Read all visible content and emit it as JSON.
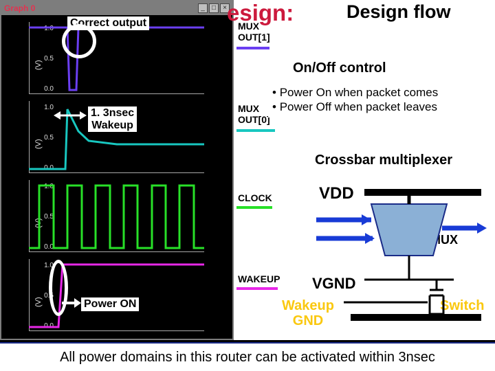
{
  "window": {
    "title": "Graph 0",
    "buttons": {
      "min": "_",
      "max": "□",
      "close": "×"
    }
  },
  "axes": {
    "ylabel": "(V)",
    "yticks": [
      "0.0",
      "0.5",
      "1.0"
    ]
  },
  "chart_data": [
    {
      "type": "line",
      "name": "MUX OUT[1]",
      "color": "#6b3ff2",
      "ylabel": "(V)",
      "ylim": [
        0,
        1.0
      ],
      "description": "Digital output high (~1V) with brief glitch fall near t=0.25 then returns high",
      "points": [
        [
          0,
          1
        ],
        [
          0.22,
          1
        ],
        [
          0.23,
          0.02
        ],
        [
          0.27,
          0.02
        ],
        [
          0.28,
          1
        ],
        [
          1,
          1
        ]
      ]
    },
    {
      "type": "line",
      "name": "MUX OUT[0]",
      "color": "#18c7c0",
      "ylabel": "(V)",
      "ylim": [
        0,
        1.0
      ],
      "description": "Starts at 0V, step rise to ~1V at t≈0.22 with overshoot decay",
      "points": [
        [
          0,
          0
        ],
        [
          0.21,
          0
        ],
        [
          0.22,
          0.95
        ],
        [
          0.28,
          0.6
        ],
        [
          0.34,
          0.45
        ],
        [
          0.5,
          0.4
        ],
        [
          0.7,
          0.4
        ],
        [
          1,
          0.4
        ]
      ]
    },
    {
      "type": "line",
      "name": "CLOCK",
      "color": "#28e028",
      "ylabel": "(V)",
      "ylim": [
        0,
        1.0
      ],
      "description": "Square-wave clock, ~6 periods, 0–1V",
      "points": [
        [
          0,
          0
        ],
        [
          0.06,
          0
        ],
        [
          0.06,
          1
        ],
        [
          0.14,
          1
        ],
        [
          0.14,
          0
        ],
        [
          0.22,
          0
        ],
        [
          0.22,
          1
        ],
        [
          0.3,
          1
        ],
        [
          0.3,
          0
        ],
        [
          0.38,
          0
        ],
        [
          0.38,
          1
        ],
        [
          0.46,
          1
        ],
        [
          0.46,
          0
        ],
        [
          0.54,
          0
        ],
        [
          0.54,
          1
        ],
        [
          0.62,
          1
        ],
        [
          0.62,
          0
        ],
        [
          0.7,
          0
        ],
        [
          0.7,
          1
        ],
        [
          0.78,
          1
        ],
        [
          0.78,
          0
        ],
        [
          0.86,
          0
        ],
        [
          0.86,
          1
        ],
        [
          0.94,
          1
        ],
        [
          0.94,
          0
        ],
        [
          1,
          0
        ]
      ]
    },
    {
      "type": "line",
      "name": "WAKEUP",
      "color": "#e828e8",
      "ylabel": "(V)",
      "ylim": [
        0,
        1.0
      ],
      "description": "Rising edge low→high at t≈0.18",
      "points": [
        [
          0,
          0
        ],
        [
          0.17,
          0
        ],
        [
          0.19,
          1
        ],
        [
          1,
          1
        ]
      ]
    }
  ],
  "annotations": {
    "correct_output": "Correct output",
    "wakeup_time": "1. 3nsec\nWakeup",
    "power_on": "Power ON"
  },
  "legend": {
    "mux1": "MUX\nOUT[1]",
    "mux0": "MUX\nOUT[0]",
    "clock": "CLOCK",
    "wakeup": "WAKEUP"
  },
  "right": {
    "heading_fragment": "esign:",
    "subheading": "Design flow",
    "onoff_header": "On/Off control",
    "onoff_bullets": [
      "Power On when packet comes",
      "Power Off when packet leaves"
    ],
    "crossbar_header": "Crossbar multiplexer",
    "vdd": "VDD",
    "vgnd": "VGND",
    "mux_box": "MUX",
    "wakeup_gnd": "Wakeup\nGND",
    "switch": "Switch"
  },
  "bottom": "All power domains in this router can be activated within 3nsec"
}
